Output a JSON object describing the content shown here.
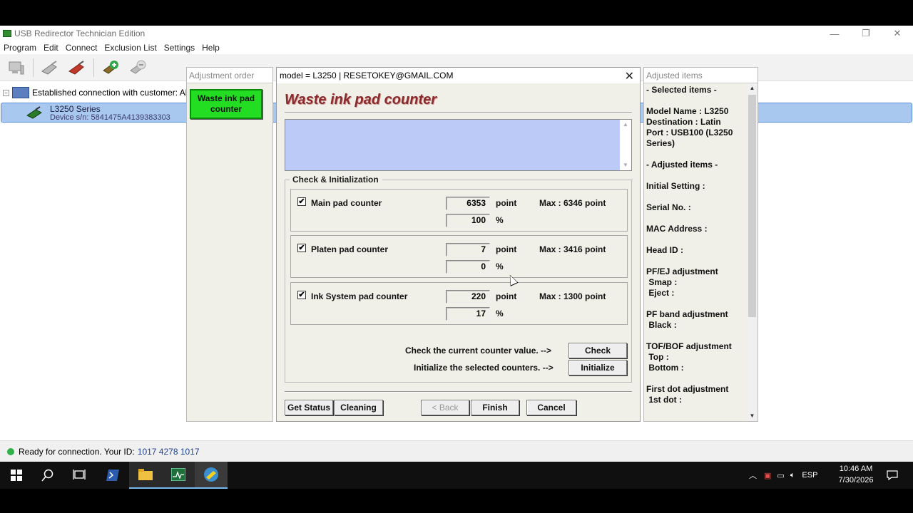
{
  "app": {
    "title": "USB Redirector Technician Edition",
    "window_buttons": [
      "—",
      "❐",
      "✕"
    ]
  },
  "menu": [
    "Program",
    "Edit",
    "Connect",
    "Exclusion List",
    "Settings",
    "Help"
  ],
  "tree": {
    "connection": "Established connection with customer: Albe",
    "device_name": "L3250 Series",
    "device_sn": "Device s/n: 5841475A4139383303"
  },
  "adjustment_order": {
    "header": "Adjustment order",
    "button": "Waste ink pad counter"
  },
  "dialog": {
    "title": "model = L3250 | RESETOKEY@GMAIL.COM",
    "heading": "Waste ink pad counter",
    "group_label": "Check & Initialization",
    "counters": [
      {
        "label": "Main pad counter",
        "checked": "✔",
        "point": "6353",
        "percent": "100",
        "max": "Max : 6346 point"
      },
      {
        "label": "Platen pad counter",
        "checked": "✔",
        "point": "7",
        "percent": "0",
        "max": "Max : 3416 point"
      },
      {
        "label": "Ink System pad counter",
        "checked": "✔",
        "point": "220",
        "percent": "17",
        "max": "Max : 1300 point"
      }
    ],
    "unit_point": "point",
    "unit_percent": "%",
    "check_hint": "Check the current counter value. -->",
    "init_hint": "Initialize the selected counters. -->",
    "check_button": "Check",
    "initialize_button": "Initialize",
    "get_status": "Get Status",
    "cleaning": "Cleaning",
    "back": "< Back",
    "finish": "Finish",
    "cancel": "Cancel"
  },
  "adjusted_items": {
    "header": "Adjusted items",
    "lines": [
      "- Selected items -",
      "",
      "Model Name : L3250",
      "Destination : Latin",
      "Port : USB100 (L3250",
      "Series)",
      "",
      "- Adjusted items -",
      "",
      "Initial Setting :",
      "",
      "Serial No. :",
      "",
      "MAC Address :",
      "",
      "Head ID :",
      "",
      "PF/EJ adjustment",
      " Smap :",
      " Eject :",
      "",
      "PF band adjustment",
      " Black :",
      "",
      "TOF/BOF adjustment",
      " Top :",
      " Bottom :",
      "",
      "First dot adjustment",
      " 1st dot :"
    ]
  },
  "status": {
    "text": "Ready for connection. Your ID:",
    "id": "1017 4278 1017",
    "color": "#2fb24a"
  },
  "taskbar": {
    "language": "ESP",
    "time": "10:46 AM",
    "date": "7/30/2026"
  }
}
